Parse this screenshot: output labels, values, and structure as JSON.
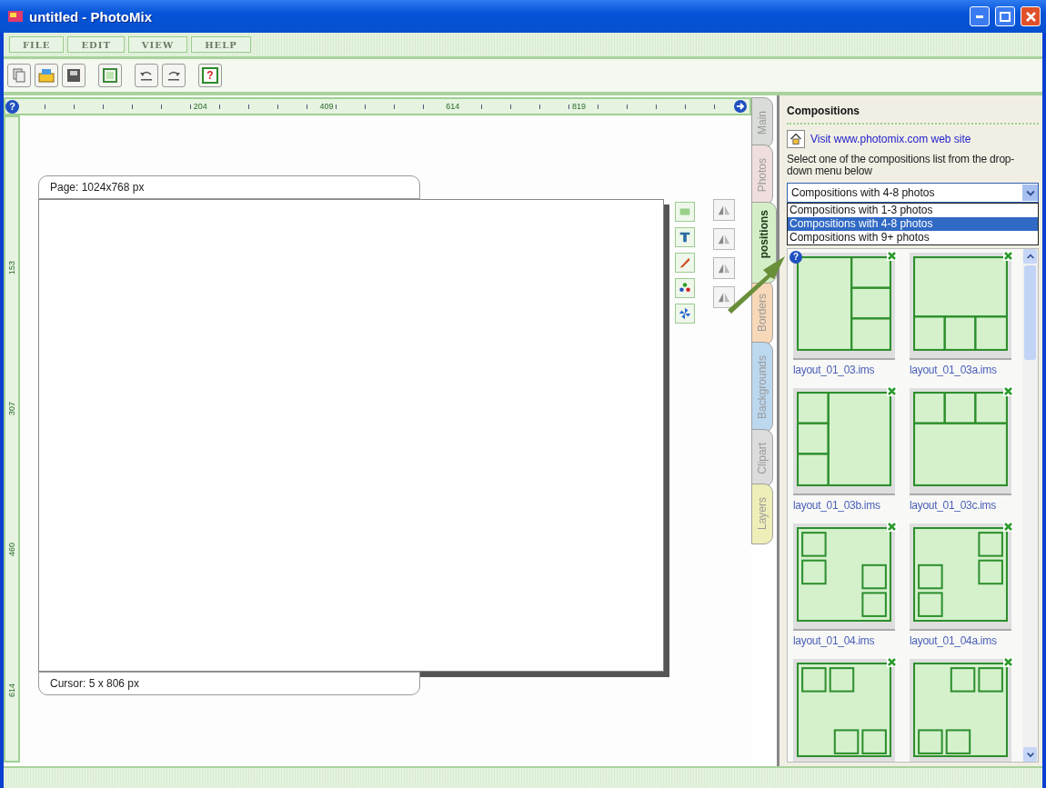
{
  "window": {
    "title": "untitled - PhotoMix"
  },
  "menu": [
    "FILE",
    "EDIT",
    "VIEW",
    "HELP"
  ],
  "toolbar": {
    "help_glyph": "?"
  },
  "ruler": {
    "help_glyph": "?",
    "horizontal_labels": [
      "204",
      "409",
      "614",
      "819"
    ],
    "vertical_labels": [
      "153",
      "307",
      "460",
      "614"
    ]
  },
  "canvas": {
    "page_label": "Page: 1024x768 px",
    "cursor_label": "Cursor: 5 x 806 px"
  },
  "side_tabs": [
    {
      "label": "Main",
      "selected": false,
      "color": "#d9dcd8"
    },
    {
      "label": "Photos",
      "selected": false,
      "color": "#f0dede"
    },
    {
      "label": "positions",
      "selected": true,
      "color": "#d4efc8"
    },
    {
      "label": "Borders",
      "selected": false,
      "color": "#f7d8b8"
    },
    {
      "label": "Backgrounds",
      "selected": false,
      "color": "#bcd8ef"
    },
    {
      "label": "Clipart",
      "selected": false,
      "color": "#dcdcdc"
    },
    {
      "label": "Layers",
      "selected": false,
      "color": "#eeeeb8"
    }
  ],
  "panel": {
    "title": "Compositions",
    "link": "Visit www.photomix.com web site",
    "description": "Select one of the compositions list from the drop-down menu below",
    "select": {
      "value": "Compositions with 4-8 photos",
      "expanded": true
    },
    "options": [
      {
        "label": "Compositions with 1-3 photos",
        "selected": false
      },
      {
        "label": "Compositions with 4-8 photos",
        "selected": true
      },
      {
        "label": "Compositions with 9+ photos",
        "selected": false
      }
    ],
    "grid_help_glyph": "?",
    "thumbnails": [
      {
        "label": "layout_01_03.ims"
      },
      {
        "label": "layout_01_03a.ims"
      },
      {
        "label": "layout_01_03b.ims"
      },
      {
        "label": "layout_01_03c.ims"
      },
      {
        "label": "layout_01_04.ims"
      },
      {
        "label": "layout_01_04a.ims"
      }
    ]
  }
}
